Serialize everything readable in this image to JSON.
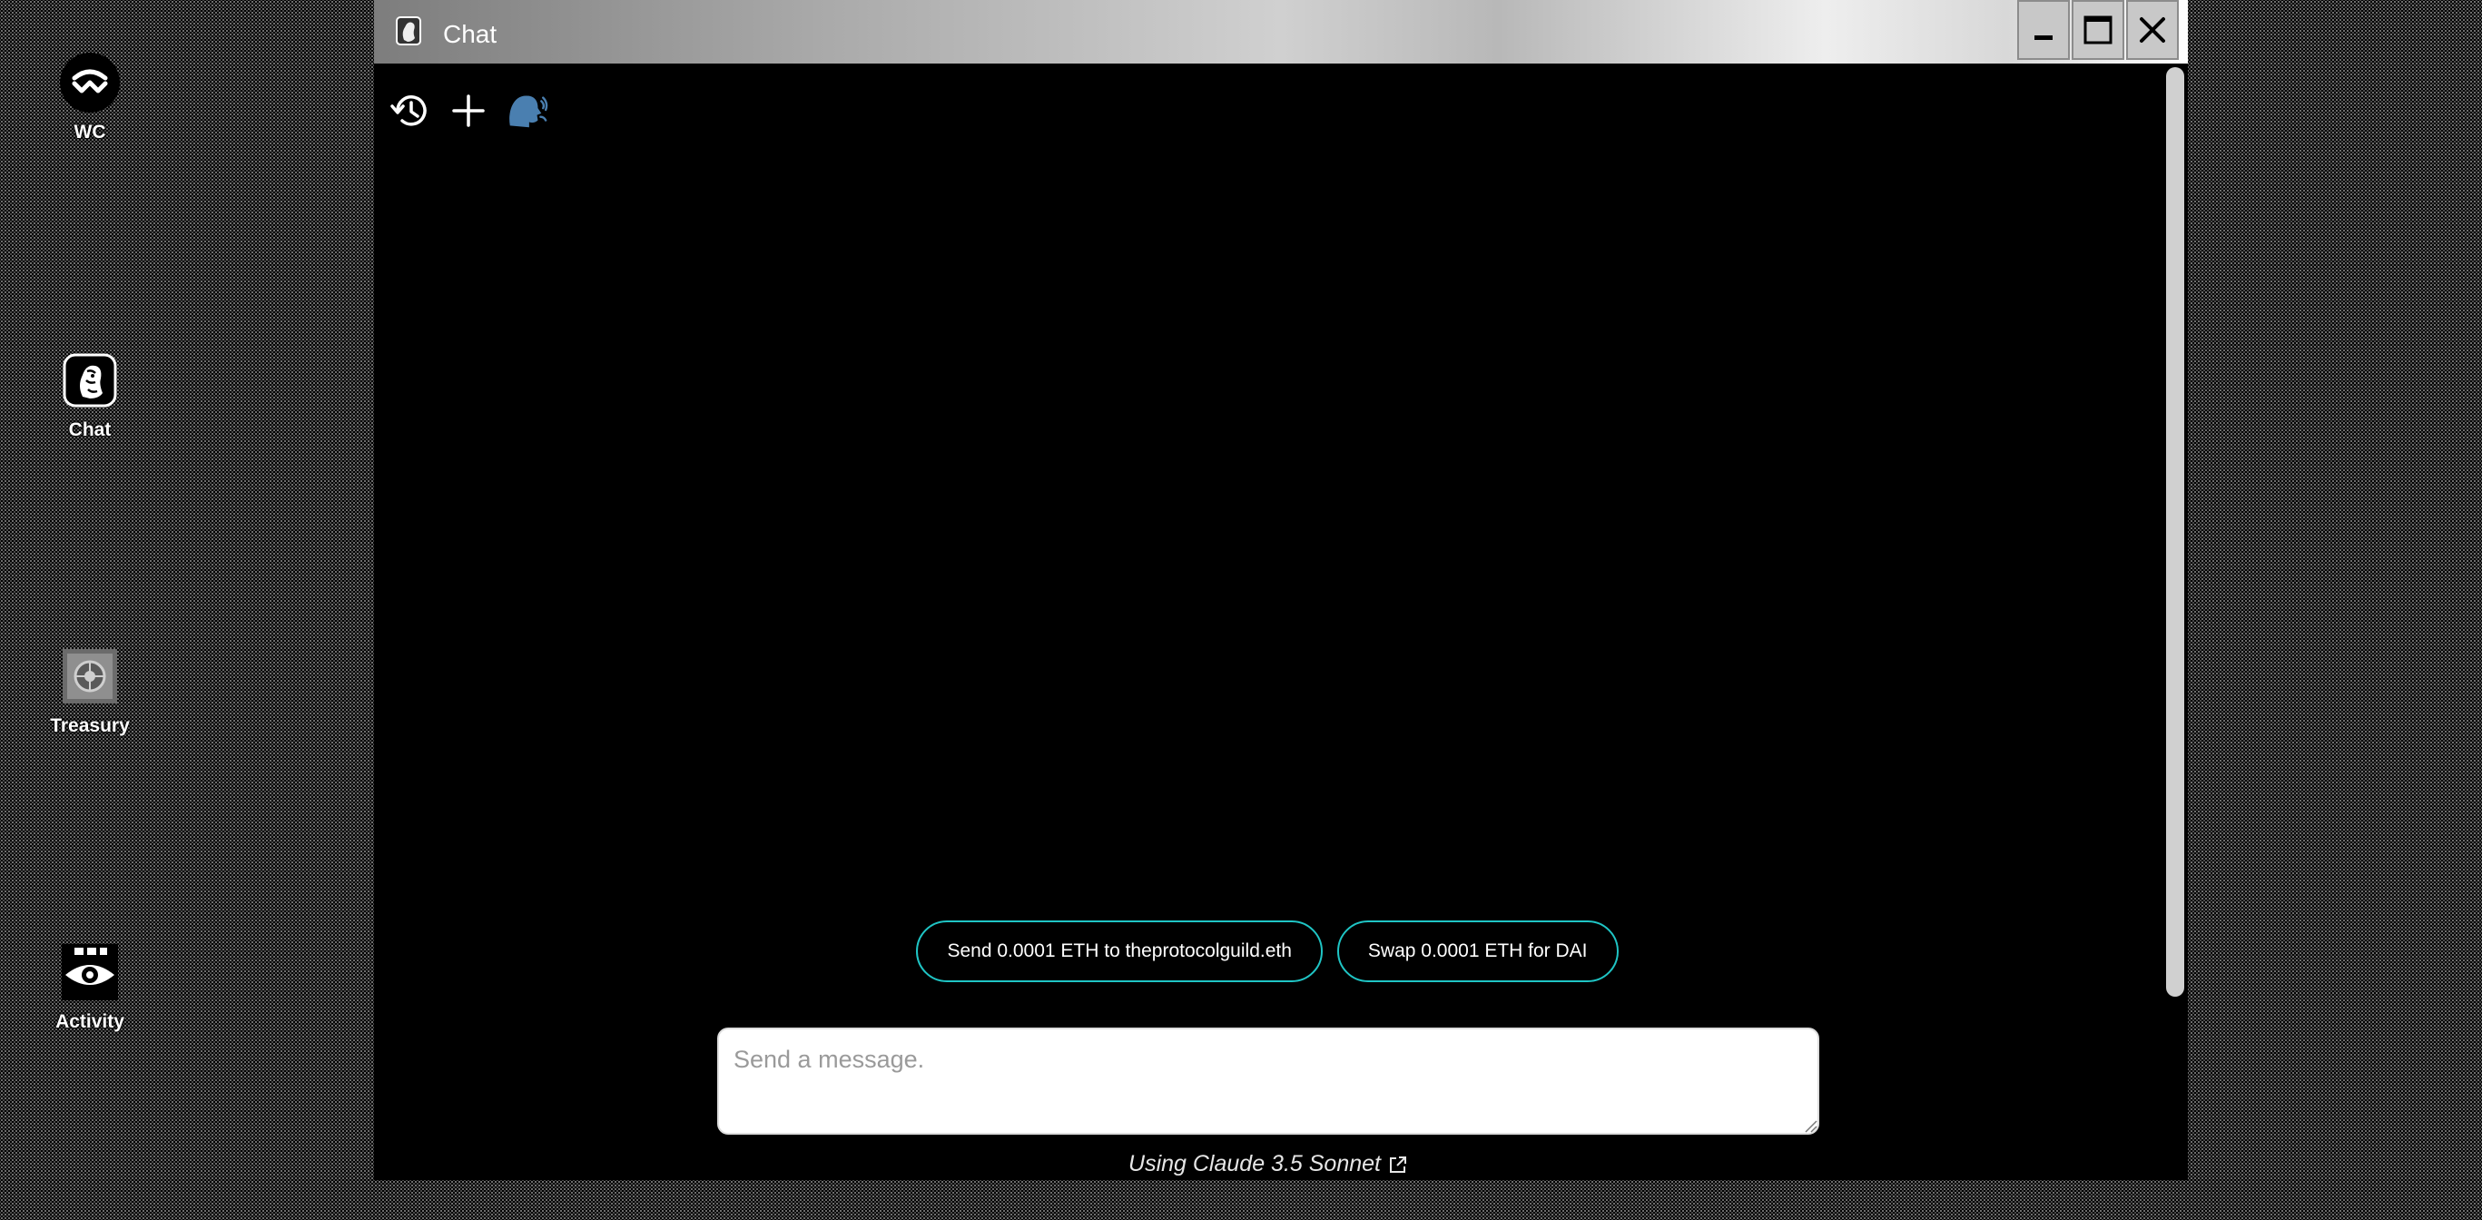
{
  "desktop": {
    "icons": [
      {
        "label": "WC",
        "icon": "walletconnect-icon"
      },
      {
        "label": "Chat",
        "icon": "chat-icon"
      },
      {
        "label": "Treasury",
        "icon": "treasury-icon"
      },
      {
        "label": "Activity",
        "icon": "activity-icon"
      }
    ]
  },
  "window": {
    "title": "Chat",
    "controls": [
      "minimize",
      "maximize",
      "close"
    ]
  },
  "toolbar": {
    "buttons": [
      "history-icon",
      "new-chat-icon",
      "voice-icon"
    ]
  },
  "suggestions": [
    "Send 0.0001 ETH to theprotocolguild.eth",
    "Swap 0.0001 ETH for DAI"
  ],
  "composer": {
    "placeholder": "Send a message.",
    "value": ""
  },
  "footer": {
    "model_text": "Using Claude 3.5 Sonnet"
  },
  "colors": {
    "suggestion_border": "#1fc5c5",
    "window_background": "#000000"
  }
}
